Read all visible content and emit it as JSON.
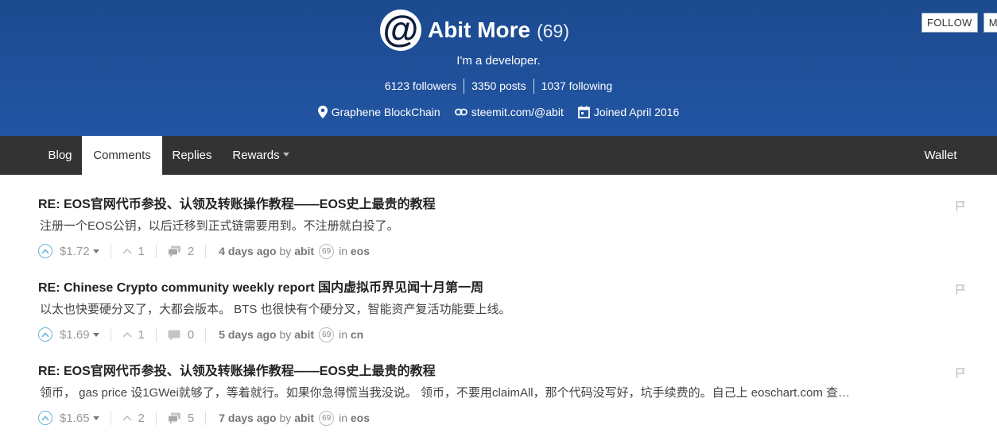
{
  "profile": {
    "avatar_glyph": "@",
    "name": "Abit More",
    "reputation": "(69)",
    "about": "I'm a developer.",
    "followers": "6123 followers",
    "posts": "3350 posts",
    "following": "1037 following",
    "location": "Graphene BlockChain",
    "website": "steemit.com/@abit",
    "joined": "Joined April 2016",
    "follow_label": "FOLLOW",
    "mute_label": "MU"
  },
  "tabs": [
    {
      "label": "Blog"
    },
    {
      "label": "Comments",
      "active": true
    },
    {
      "label": "Replies"
    },
    {
      "label": "Rewards"
    }
  ],
  "wallet_label": "Wallet",
  "comments": [
    {
      "title": "RE: EOS官网代币参投、认领及转账操作教程——EOS史上最贵的教程",
      "body": "注册一个EOS公钥，以后迁移到正式链需要用到。不注册就白投了。",
      "payout": "$1.72",
      "votes": "1",
      "replies": "2",
      "time": "4 days ago",
      "by": "by",
      "author": "abit",
      "author_rep": "69",
      "in": "in",
      "category": "eos"
    },
    {
      "title": "RE: Chinese Crypto community weekly report 国内虚拟币界见闻十月第一周",
      "body": "以太也快要硬分叉了，大都会版本。 BTS 也很快有个硬分叉，智能资产复活功能要上线。",
      "payout": "$1.69",
      "votes": "1",
      "replies": "0",
      "time": "5 days ago",
      "by": "by",
      "author": "abit",
      "author_rep": "69",
      "in": "in",
      "category": "cn"
    },
    {
      "title": "RE: EOS官网代币参投、认领及转账操作教程——EOS史上最贵的教程",
      "body": "领币， gas price 设1GWei就够了，等着就行。如果你急得慌当我没说。 领币，不要用claimAll，那个代码没写好，坑手续费的。自己上 eoschart.com 查…",
      "payout": "$1.65",
      "votes": "2",
      "replies": "5",
      "time": "7 days ago",
      "by": "by",
      "author": "abit",
      "author_rep": "69",
      "in": "in",
      "category": "eos"
    }
  ],
  "colors": {
    "header_bg": "#1f4f96",
    "tabs_bg": "#333333",
    "upvote_accent": "#6ab4d8"
  }
}
